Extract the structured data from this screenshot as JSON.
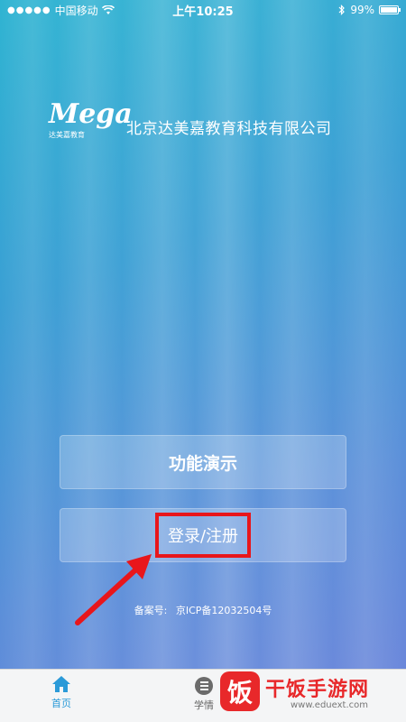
{
  "status_bar": {
    "carrier": "中国移动",
    "time": "上午10:25",
    "battery": "99%",
    "battery_level": 0.99
  },
  "header": {
    "logo_text": "Mega",
    "logo_subtext": "达美嘉教育",
    "company_name": "北京达美嘉教育科技有限公司"
  },
  "buttons": {
    "demo_label": "功能演示",
    "login_label": "登录/注册"
  },
  "icp": {
    "label": "备案号:",
    "number": "京ICP备12032504号"
  },
  "tabbar": {
    "home_label": "首页",
    "study_label": "学情"
  },
  "watermark": {
    "logo_char": "饭",
    "name": "干饭手游网",
    "url": "www.eduext.com"
  },
  "colors": {
    "accent": "#2b9ad8",
    "highlight": "#e8161b",
    "watermark": "#e8282a"
  }
}
